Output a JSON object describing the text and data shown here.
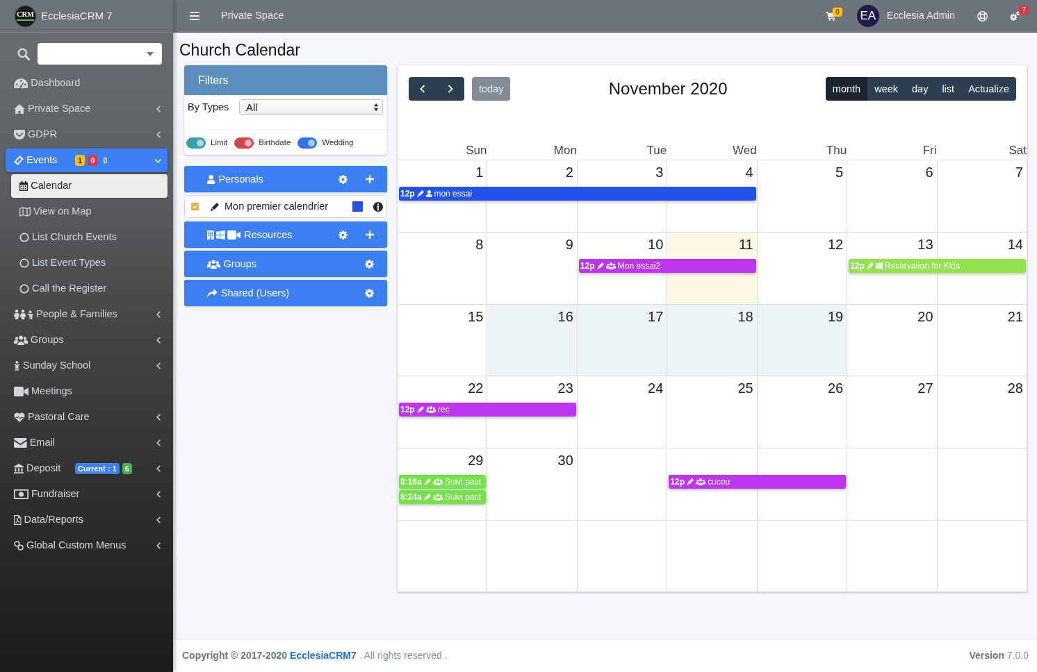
{
  "sidebar": {
    "brand": {
      "logo": "CRM",
      "name": "EcclesiaCRM 7"
    },
    "items": [
      {
        "label": "Dashboard",
        "submenu": false,
        "expanded": false,
        "selected": false
      },
      {
        "label": "Private Space",
        "submenu": true,
        "expanded": false,
        "selected": false
      },
      {
        "label": "GDPR",
        "submenu": true,
        "expanded": false,
        "selected": false
      },
      {
        "label": "Events",
        "submenu": true,
        "expanded": true,
        "selected": true,
        "badges": [
          {
            "text": "1",
            "color": "#ffc107"
          },
          {
            "text": "0",
            "color": "#dc3545"
          },
          {
            "text": "0",
            "color": "#3d80f3"
          }
        ],
        "children": [
          {
            "label": "Calendar",
            "selected": true
          },
          {
            "label": "View on Map",
            "selected": false
          },
          {
            "label": "List Church Events",
            "selected": false
          },
          {
            "label": "List Event Types",
            "selected": false
          },
          {
            "label": "Call the Register",
            "selected": false
          }
        ]
      },
      {
        "label": "People & Families",
        "submenu": true,
        "expanded": false,
        "selected": false
      },
      {
        "label": "Groups",
        "submenu": true,
        "expanded": false,
        "selected": false
      },
      {
        "label": "Sunday School",
        "submenu": true,
        "expanded": false,
        "selected": false
      },
      {
        "label": "Meetings",
        "submenu": false,
        "expanded": false,
        "selected": false
      },
      {
        "label": "Pastoral Care",
        "submenu": true,
        "expanded": false,
        "selected": false
      },
      {
        "label": "Email",
        "submenu": true,
        "expanded": false,
        "selected": false
      },
      {
        "label": "Deposit",
        "submenu": true,
        "expanded": false,
        "selected": false,
        "badges": [
          {
            "text": "Current : 1",
            "color": "#3d80f3"
          },
          {
            "text": "6",
            "color": "#4cae4c"
          }
        ]
      },
      {
        "label": "Fundraiser",
        "submenu": true,
        "expanded": false,
        "selected": false
      },
      {
        "label": "Data/Reports",
        "submenu": true,
        "expanded": false,
        "selected": false
      },
      {
        "label": "Global Custom Menus",
        "submenu": true,
        "expanded": false,
        "selected": false
      }
    ]
  },
  "topbar": {
    "title": "Private Space",
    "cart_count": "0",
    "user_initials": "EA",
    "user_name": "Ecclesia Admin",
    "alerts_count": "7"
  },
  "page_title": "Church Calendar",
  "filters": {
    "title": "Filters",
    "type_filter": {
      "label": "By Types",
      "value": "All"
    },
    "toggles": [
      {
        "label": "Limit",
        "on": true,
        "color": "#3a9fb1"
      },
      {
        "label": "Birthdate",
        "on": true,
        "color": "#d5444c"
      },
      {
        "label": "Wedding",
        "on": true,
        "color": "#2f76ec"
      }
    ]
  },
  "calendar_groups": [
    {
      "title": "Personals",
      "can_add": true,
      "calendars": [
        {
          "name": "Mon premier calendrier",
          "checked": true,
          "color": "#2352eb"
        }
      ]
    },
    {
      "title": "Resources",
      "can_add": true
    },
    {
      "title": "Groups",
      "can_add": false
    },
    {
      "title": "Shared (Users)",
      "can_add": false
    }
  ],
  "calendar": {
    "today_label": "today",
    "title": "November 2020",
    "views": [
      {
        "label": "month",
        "selected": true
      },
      {
        "label": "week",
        "selected": false
      },
      {
        "label": "day",
        "selected": false
      },
      {
        "label": "list",
        "selected": false
      }
    ],
    "actualize": "Actualize",
    "weekdays": [
      "Sun",
      "Mon",
      "Tue",
      "Wed",
      "Thu",
      "Fri",
      "Sat"
    ],
    "weeks": [
      {
        "days": [
          {
            "number": "1",
            "today": false,
            "highlighted": false,
            "events": [
              {
                "kind": "personal",
                "time": "12p",
                "title": "mon essai",
                "color": "#2352eb"
              }
            ]
          },
          {
            "number": "2",
            "today": false,
            "highlighted": false,
            "events": [
              {
                "kind": "continued"
              }
            ]
          },
          {
            "number": "3",
            "today": false,
            "highlighted": false,
            "events": [
              {
                "kind": "continued"
              }
            ]
          },
          {
            "number": "4",
            "today": false,
            "highlighted": false,
            "events": [
              {
                "kind": "continued"
              }
            ]
          },
          {
            "number": "5",
            "today": false,
            "highlighted": false
          },
          {
            "number": "6",
            "today": false,
            "highlighted": false
          },
          {
            "number": "7",
            "today": false,
            "highlighted": false
          }
        ]
      },
      {
        "days": [
          {
            "number": "8",
            "today": false,
            "highlighted": false
          },
          {
            "number": "9",
            "today": false,
            "highlighted": false
          },
          {
            "number": "10",
            "today": false,
            "highlighted": false,
            "events": [
              {
                "kind": "group",
                "time": "12p",
                "title": "Mon essai2",
                "color": "#bb36ec"
              }
            ]
          },
          {
            "number": "11",
            "today": true,
            "highlighted": false,
            "events": [
              {
                "kind": "continued"
              }
            ]
          },
          {
            "number": "12",
            "today": false,
            "highlighted": false
          },
          {
            "number": "13",
            "today": false,
            "highlighted": false,
            "events": [
              {
                "kind": "resource",
                "time": "12p",
                "title": "Reservation for Kids",
                "color": "#92e34f"
              }
            ]
          },
          {
            "number": "14",
            "today": false,
            "highlighted": false,
            "events": [
              {
                "kind": "continued"
              }
            ]
          }
        ]
      },
      {
        "days": [
          {
            "number": "15",
            "today": false,
            "highlighted": false
          },
          {
            "number": "16",
            "today": false,
            "highlighted": true
          },
          {
            "number": "17",
            "today": false,
            "highlighted": true
          },
          {
            "number": "18",
            "today": false,
            "highlighted": true
          },
          {
            "number": "19",
            "today": false,
            "highlighted": true
          },
          {
            "number": "20",
            "today": false,
            "highlighted": false
          },
          {
            "number": "21",
            "today": false,
            "highlighted": false
          }
        ]
      },
      {
        "days": [
          {
            "number": "22",
            "today": false,
            "highlighted": false,
            "events": [
              {
                "kind": "group",
                "time": "12p",
                "title": "réc",
                "color": "#bb36ec"
              }
            ]
          },
          {
            "number": "23",
            "today": false,
            "highlighted": false,
            "events": [
              {
                "kind": "continued"
              }
            ]
          },
          {
            "number": "24",
            "today": false,
            "highlighted": false
          },
          {
            "number": "25",
            "today": false,
            "highlighted": false
          },
          {
            "number": "26",
            "today": false,
            "highlighted": false
          },
          {
            "number": "27",
            "today": false,
            "highlighted": false
          },
          {
            "number": "28",
            "today": false,
            "highlighted": false
          }
        ]
      },
      {
        "days": [
          {
            "number": "29",
            "today": false,
            "highlighted": false,
            "events": [
              {
                "kind": "group",
                "time": "8:16a",
                "title": "Suivi past",
                "color": "#74e24b"
              },
              {
                "kind": "group",
                "time": "8:24a",
                "title": "Suivi past",
                "color": "#74e24b"
              }
            ]
          },
          {
            "number": "30",
            "today": false,
            "highlighted": false
          },
          {
            "today": false,
            "highlighted": false
          },
          {
            "today": false,
            "highlighted": false,
            "events": [
              {
                "kind": "group",
                "time": "12p",
                "title": "cucou",
                "color": "#bb36ec"
              }
            ]
          },
          {
            "today": false,
            "highlighted": false,
            "events": [
              {
                "kind": "continued"
              }
            ]
          },
          {
            "today": false,
            "highlighted": false
          },
          {
            "today": false,
            "highlighted": false
          }
        ]
      },
      {
        "days": [
          {
            "today": false,
            "highlighted": false
          },
          {
            "today": false,
            "highlighted": false
          },
          {
            "today": false,
            "highlighted": false
          },
          {
            "today": false,
            "highlighted": false
          },
          {
            "today": false,
            "highlighted": false
          },
          {
            "today": false,
            "highlighted": false
          },
          {
            "today": false,
            "highlighted": false
          }
        ]
      }
    ]
  },
  "footer": {
    "copyright": "Copyright © 2017-2020",
    "link": "EcclesiaCRM7",
    "rights": ". All rights reserved .",
    "version": "**Version** 7.0.0"
  }
}
